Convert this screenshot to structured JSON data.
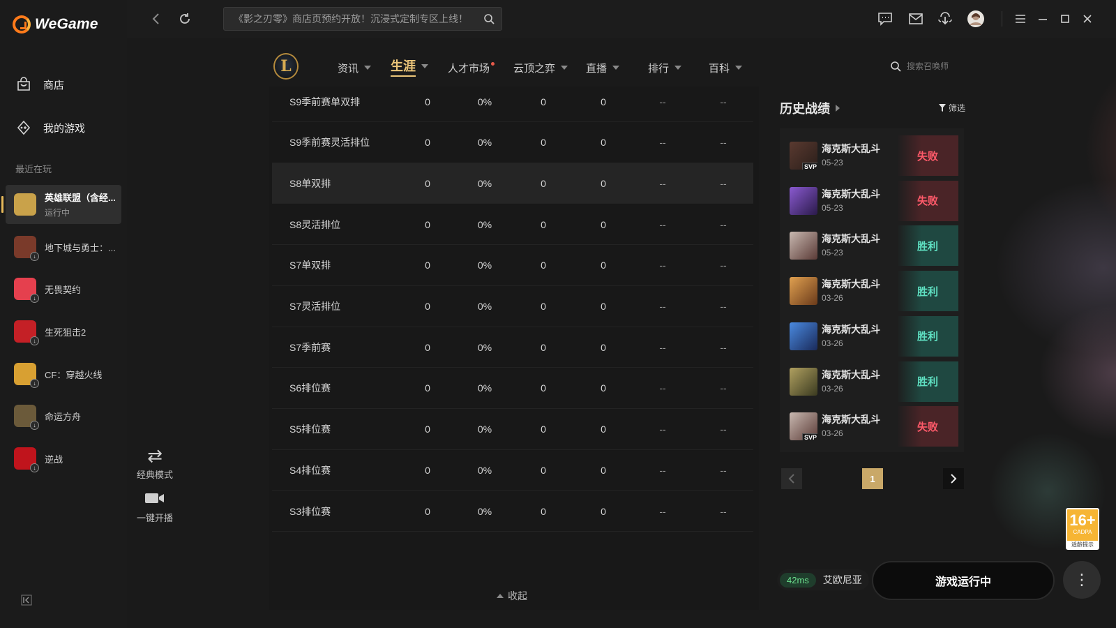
{
  "app": {
    "logo_text": "WeGame"
  },
  "sidebar": {
    "nav": [
      {
        "label": "商店",
        "icon": "shop-bag-icon"
      },
      {
        "label": "我的游戏",
        "icon": "game-controller-icon"
      }
    ],
    "recent_title": "最近在玩",
    "games": [
      {
        "name": "英雄联盟（含经...",
        "status": "运行中",
        "active": true,
        "icon": "league-of-legends-icon",
        "color": "#c9a24a"
      },
      {
        "name": "地下城与勇士：...",
        "status": "",
        "icon": "dnf-icon",
        "color": "#7a3a2a"
      },
      {
        "name": "无畏契约",
        "status": "",
        "icon": "valorant-icon",
        "color": "#e5404e"
      },
      {
        "name": "生死狙击2",
        "status": "",
        "icon": "sniper-icon",
        "color": "#c42026"
      },
      {
        "name": "CF：穿越火线",
        "status": "",
        "icon": "crossfire-icon",
        "color": "#d8a032"
      },
      {
        "name": "命运方舟",
        "status": "",
        "icon": "lost-ark-icon",
        "color": "#6b5a3a"
      },
      {
        "name": "逆战",
        "status": "",
        "icon": "nizhan-icon",
        "color": "#c0141c"
      }
    ]
  },
  "topbar": {
    "search_text": "《影之刃零》商店页预约开放！沉浸式定制专区上线！"
  },
  "lol_nav": {
    "items": [
      {
        "label": "资讯",
        "caret": true
      },
      {
        "label": "生涯",
        "caret": true,
        "active": true
      },
      {
        "label": "人才市场",
        "caret": false,
        "dot": true
      },
      {
        "label": "云顶之弈",
        "caret": true
      },
      {
        "label": "直播",
        "caret": true
      },
      {
        "label": "排行",
        "caret": true
      },
      {
        "label": "百科",
        "caret": true
      }
    ],
    "summoner_search_placeholder": "搜索召唤师"
  },
  "left_tools": {
    "mode_label": "经典模式",
    "stream_label": "一键开播"
  },
  "stats_table": {
    "rows": [
      [
        "S9季前赛单双排",
        "0",
        "0%",
        "0",
        "0",
        "--",
        "--"
      ],
      [
        "S9季前赛灵活排位",
        "0",
        "0%",
        "0",
        "0",
        "--",
        "--"
      ],
      [
        "S8单双排",
        "0",
        "0%",
        "0",
        "0",
        "--",
        "--"
      ],
      [
        "S8灵活排位",
        "0",
        "0%",
        "0",
        "0",
        "--",
        "--"
      ],
      [
        "S7单双排",
        "0",
        "0%",
        "0",
        "0",
        "--",
        "--"
      ],
      [
        "S7灵活排位",
        "0",
        "0%",
        "0",
        "0",
        "--",
        "--"
      ],
      [
        "S7季前赛",
        "0",
        "0%",
        "0",
        "0",
        "--",
        "--"
      ],
      [
        "S6排位赛",
        "0",
        "0%",
        "0",
        "0",
        "--",
        "--"
      ],
      [
        "S5排位赛",
        "0",
        "0%",
        "0",
        "0",
        "--",
        "--"
      ],
      [
        "S4排位赛",
        "0",
        "0%",
        "0",
        "0",
        "--",
        "--"
      ],
      [
        "S3排位赛",
        "0",
        "0%",
        "0",
        "0",
        "--",
        "--"
      ]
    ],
    "highlight_row": 2,
    "collapse_label": "收起"
  },
  "history": {
    "title": "历史战绩",
    "filter_label": "筛选",
    "matches": [
      {
        "mode": "海克斯大乱斗",
        "date": "05-23",
        "result": "失败",
        "outcome": "loss",
        "svp": "SVP",
        "champ_colors": [
          "#5a3a30",
          "#2a1e1a"
        ]
      },
      {
        "mode": "海克斯大乱斗",
        "date": "05-23",
        "result": "失败",
        "outcome": "loss",
        "svp": "",
        "champ_colors": [
          "#8a5ad0",
          "#2a1a4a"
        ]
      },
      {
        "mode": "海克斯大乱斗",
        "date": "05-23",
        "result": "胜利",
        "outcome": "win",
        "svp": "",
        "champ_colors": [
          "#c8b8b0",
          "#5a3a36"
        ]
      },
      {
        "mode": "海克斯大乱斗",
        "date": "03-26",
        "result": "胜利",
        "outcome": "win",
        "svp": "",
        "champ_colors": [
          "#e0a050",
          "#6a3a1a"
        ]
      },
      {
        "mode": "海克斯大乱斗",
        "date": "03-26",
        "result": "胜利",
        "outcome": "win",
        "svp": "",
        "champ_colors": [
          "#4a8ae0",
          "#1a2a5a"
        ]
      },
      {
        "mode": "海克斯大乱斗",
        "date": "03-26",
        "result": "胜利",
        "outcome": "win",
        "svp": "",
        "champ_colors": [
          "#b0a060",
          "#3a3a20"
        ]
      },
      {
        "mode": "海克斯大乱斗",
        "date": "03-26",
        "result": "失败",
        "outcome": "loss",
        "svp": "SVP",
        "champ_colors": [
          "#c8b8b0",
          "#5a3a36"
        ]
      }
    ],
    "page": "1"
  },
  "age_rating": {
    "big": "16+",
    "small": "CADPA",
    "tip": "适龄提示"
  },
  "bottom": {
    "ping": "42ms",
    "server": "艾欧尼亚",
    "launch_label": "游戏运行中",
    "more_glyph": "⋮"
  }
}
